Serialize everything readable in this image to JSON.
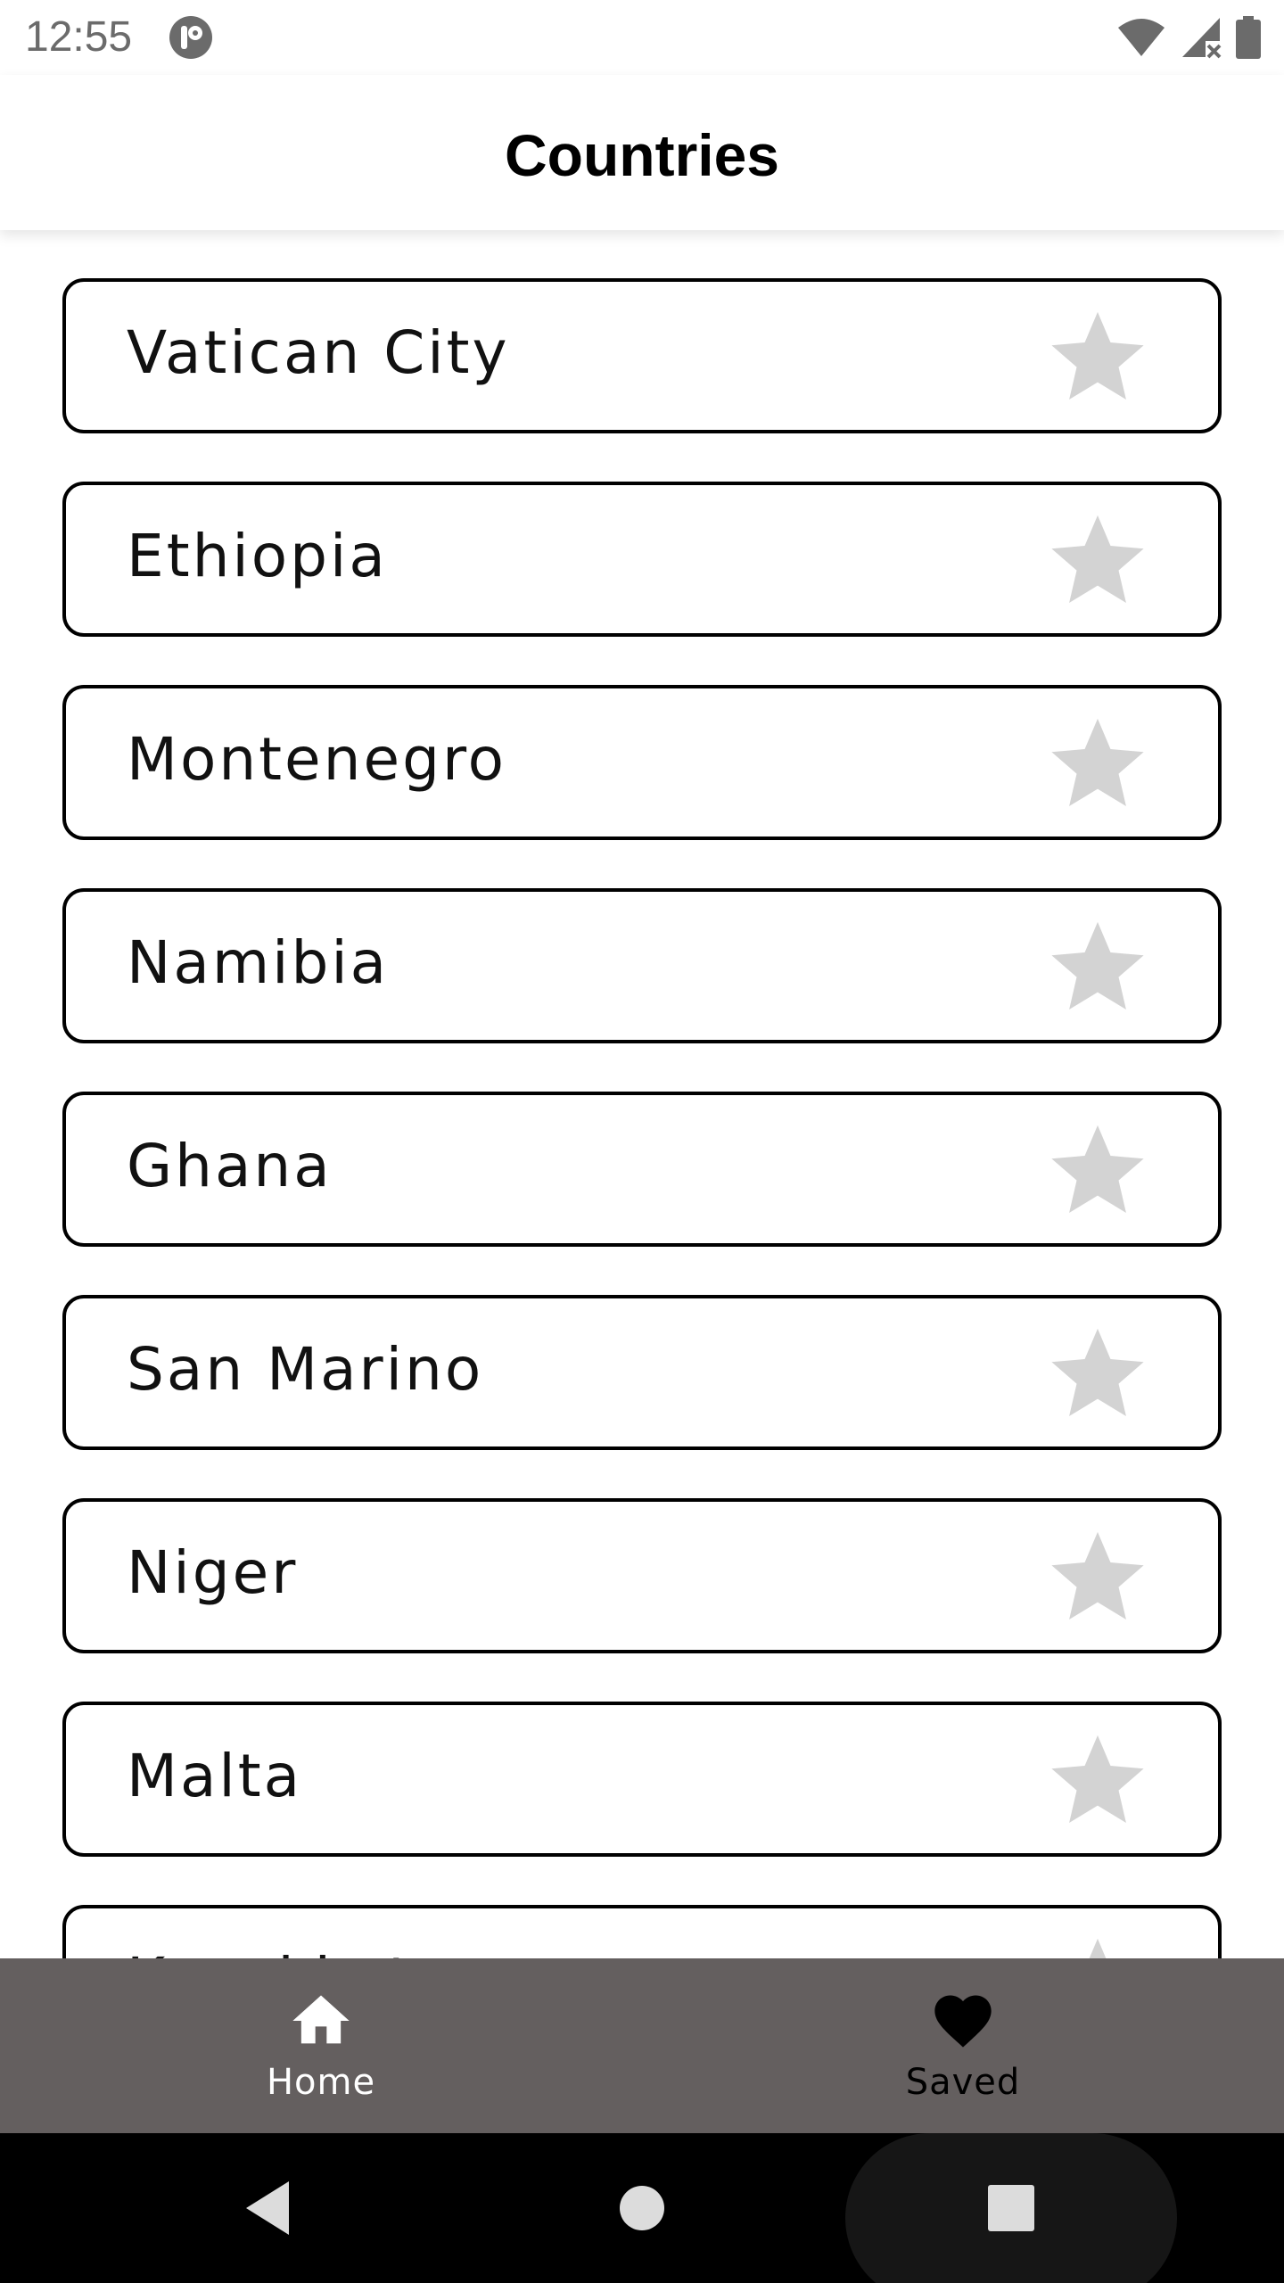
{
  "status_bar": {
    "time": "12:55",
    "icons": [
      "app-notification-icon",
      "wifi-icon",
      "signal-no-service-icon",
      "battery-icon"
    ]
  },
  "app_bar": {
    "title": "Countries"
  },
  "countries": [
    {
      "name": "Vatican City",
      "starred": false
    },
    {
      "name": "Ethiopia",
      "starred": false
    },
    {
      "name": "Montenegro",
      "starred": false
    },
    {
      "name": "Namibia",
      "starred": false
    },
    {
      "name": "Ghana",
      "starred": false
    },
    {
      "name": "San Marino",
      "starred": false
    },
    {
      "name": "Niger",
      "starred": false
    },
    {
      "name": "Malta",
      "starred": false
    },
    {
      "name": "Kazakhstan",
      "starred": false
    }
  ],
  "bottom_nav": {
    "items": [
      {
        "label": "Home",
        "icon": "home-icon",
        "active": true
      },
      {
        "label": "Saved",
        "icon": "heart-icon",
        "active": false
      }
    ]
  },
  "colors": {
    "star_inactive": "#d3d3d3",
    "bottom_nav_bg": "#645f5f",
    "card_border": "#000000",
    "system_nav_bg": "#000000"
  }
}
